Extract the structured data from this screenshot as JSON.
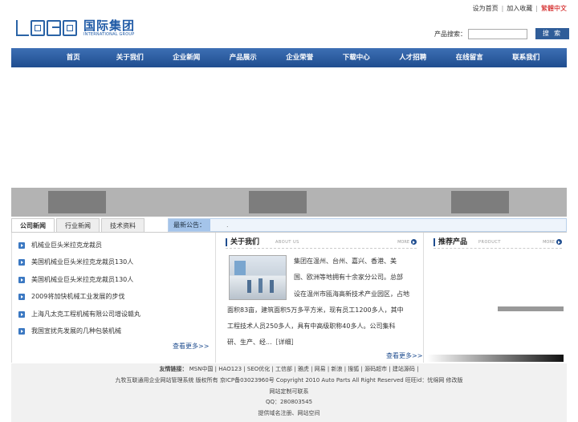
{
  "toplinks": {
    "homepage": "设为首页",
    "favorite": "加入收藏",
    "traditional": "繁體中文"
  },
  "logo": {
    "cn": "国际集团",
    "en": "INTERNATIONAL GROUP"
  },
  "search": {
    "label": "产品搜索：",
    "value": "",
    "button": "搜 索"
  },
  "nav": [
    "首页",
    "关于我们",
    "企业新闻",
    "产品展示",
    "企业荣誉",
    "下载中心",
    "人才招聘",
    "在线留言",
    "联系我们"
  ],
  "tabs": [
    "公司新闻",
    "行业新闻",
    "技术资料"
  ],
  "notice": {
    "label": "最新公告：",
    "text": "."
  },
  "news": {
    "items": [
      "机械业巨头米拉克龙裁员",
      "美国机械业巨头米拉克龙裁员130人",
      "美国机械业巨头米拉克龙裁员130人",
      "2009将加快机械工业发展的步伐",
      "上海凡太克工程机械有限公司增设赣丸",
      "我国宣扰先发展的几种包装机械"
    ],
    "more": "查看更多>>"
  },
  "about": {
    "title": "关于我们",
    "en": "ABOUT US",
    "more_tag": "MORE",
    "lines": [
      "集团在温州、台州、嘉兴、香港、美",
      "国、欧洲等地拥有十余家分公司。总部",
      "设在温州市瓯海高新技术产业园区，占地",
      "面积83亩，建筑面积5万多平方米，现有员工1200多人，其中",
      "工程技术人员250多人，具有中高级职称40多人。公司集科",
      "研、生产、经...［详细］"
    ],
    "more": "查看更多>>"
  },
  "products": {
    "title": "推荐产品",
    "en": "PRODUCT",
    "more_tag": "MORE"
  },
  "footer": {
    "links_label": "友情链接：",
    "links": "MSN中国 | HAO123 | SEO优化 | 工信部 | 雅虎 | 网易 | 新浪 | 搜狐 | 源码超市 | 建站源码 |",
    "copyright": "九牧互联通用企业网站管理系统 版权所有 京ICP备03023960号 Copyright 2010 Auto Parts All Right Reserved  旺旺id：忧绵网 修改版",
    "line3": "网站定制可联系",
    "qq": "QQ：280803545",
    "line5": "提供域名注册、网站空间"
  }
}
